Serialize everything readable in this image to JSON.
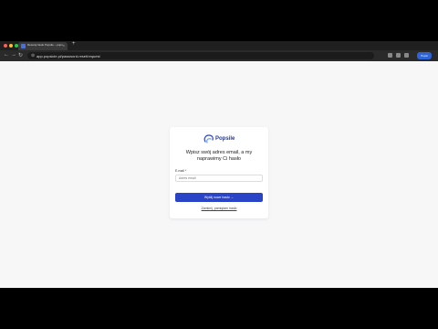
{
  "browser": {
    "tab_title": "Resetuj hasło Popsile – pops",
    "url": "app.popsicle.pl/password-reset/request",
    "extension_label": "Popsi"
  },
  "logo": {
    "text": "Popsile"
  },
  "form": {
    "heading": "Wpisz swój adres email, a my naprawimy Ci hasło",
    "email_label": "E-mail *",
    "email_placeholder": "Adres email",
    "submit_label": "Wyślij nowe hasło",
    "remember_link": "Zamknij, pamiętam hasło"
  },
  "colors": {
    "brand": "#2a44c7",
    "background": "#f7f7f8"
  }
}
